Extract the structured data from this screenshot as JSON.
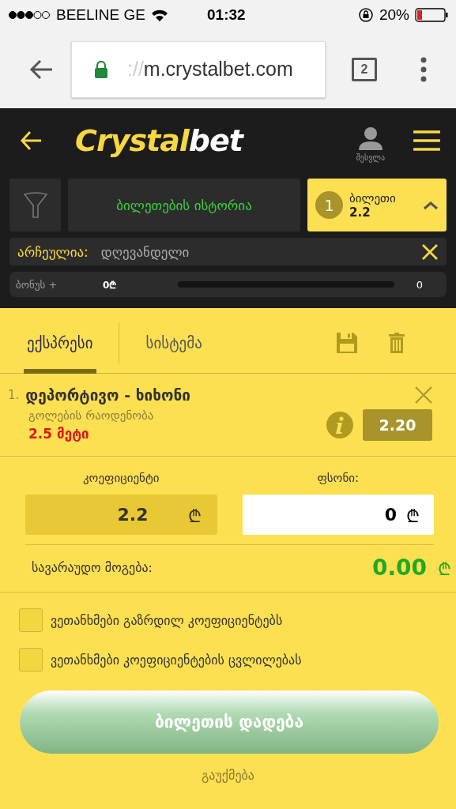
{
  "status_bar": {
    "carrier": "BEELINE GE",
    "time": "01:32",
    "battery": "20%"
  },
  "browser": {
    "url_faded": "://",
    "url": "m.crystalbet.com",
    "tab_count": "2"
  },
  "header": {
    "logo_first": "Crystal",
    "logo_second": "bet",
    "login_label": "შესვლა"
  },
  "ticket_bar": {
    "history": "ბილეთების ისტორია",
    "count": "1",
    "ticket_label": "ბილეთი",
    "ticket_odds": "2.2"
  },
  "filter": {
    "label": "არჩეულია:",
    "value": "დღევანდელი"
  },
  "bonus": {
    "label": "ბონუს +",
    "amount": "0₾",
    "value": "0",
    "level": 0
  },
  "tabs": [
    {
      "label": "ექსპრესი",
      "selected": true
    },
    {
      "label": "სისტემა",
      "selected": false
    }
  ],
  "bets": [
    {
      "number": "1.",
      "match": "დეპორტივო - ხიხონი",
      "market": "გოლების რაოდენობა",
      "pick": "2.5 მეტი",
      "odds": "2.20"
    }
  ],
  "odds_field": {
    "label": "კოეფიციენტი",
    "value": "2.2",
    "currency": "₾"
  },
  "stake_field": {
    "label": "ფსონი:",
    "value": "0",
    "currency": "₾"
  },
  "potential_win": {
    "label": "სავარაუდო მოგება:",
    "value": "0.00",
    "currency": "₾"
  },
  "agreements": [
    {
      "label": "ვეთანხმები გაზრდილ კოეფიციენტებს",
      "checked": false
    },
    {
      "label": "ვეთანხმები კოეფიციენტების ცვლილებას",
      "checked": false
    }
  ],
  "place_button": "ბილეთის დადება",
  "cancel": "გაუქმება"
}
